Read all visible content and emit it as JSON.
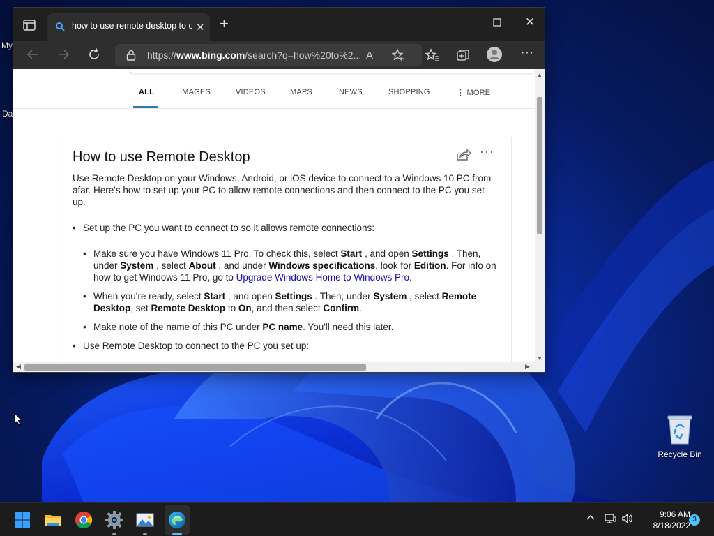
{
  "desktop": {
    "left_fragment_1": "My",
    "left_fragment_2": "Da",
    "recycle_bin_label": "Recycle Bin"
  },
  "browser": {
    "tab_title": "how to use remote desktop to co",
    "url_prefix": "https://",
    "url_host": "www.bing.com",
    "url_rest": "/search?q=how%20to%2..."
  },
  "bing": {
    "scopes": [
      "ALL",
      "IMAGES",
      "VIDEOS",
      "MAPS",
      "NEWS",
      "SHOPPING",
      "MORE"
    ],
    "active_scope": "ALL"
  },
  "answer_card": {
    "title": "How to use Remote Desktop",
    "intro": "Use Remote Desktop on your Windows, Android, or iOS device to connect to a Windows 10 PC from afar. Here's how to set up your PC to allow remote connections and then connect to the PC you set up.",
    "step1": "Set up the PC you want to connect to so it allows remote connections:",
    "step2": "Use Remote Desktop to connect to the PC you set up:",
    "sub1": {
      "t1": "Make sure you have Windows 11 Pro. To check this, select ",
      "b1": "Start",
      "t2": " , and open ",
      "b2": "Settings",
      "t3": " . Then, under ",
      "b3": "System",
      "t4": " , select ",
      "b4": "About",
      "t5": " , and under ",
      "b5": "Windows specifications",
      "t6": ", look for ",
      "b6": "Edition",
      "t7": ". For info on how to get Windows 11 Pro, go to ",
      "link": "Upgrade Windows Home to Windows Pro",
      "t8": "."
    },
    "sub2": {
      "t1": "When you're ready, select ",
      "b1": "Start",
      "t2": " , and open ",
      "b2": "Settings",
      "t3": " . Then, under ",
      "b3": "System",
      "t4": " , select ",
      "b4": "Remote Desktop",
      "t5": ", set ",
      "b5": "Remote Desktop",
      "t6": " to ",
      "b6": "On",
      "t7": ", and then select ",
      "b7": "Confirm",
      "t8": "."
    },
    "sub3": {
      "t1": "Make note of the name of this PC under ",
      "b1": "PC name",
      "t2": ". You'll need this later."
    }
  },
  "taskbar": {
    "time": "9:06 AM",
    "date": "8/18/2022",
    "notification_count": "3"
  },
  "colors": {
    "accent": "#2b7bb4",
    "link": "#1a0dab",
    "taskbar_live": "#4cc2ff"
  }
}
